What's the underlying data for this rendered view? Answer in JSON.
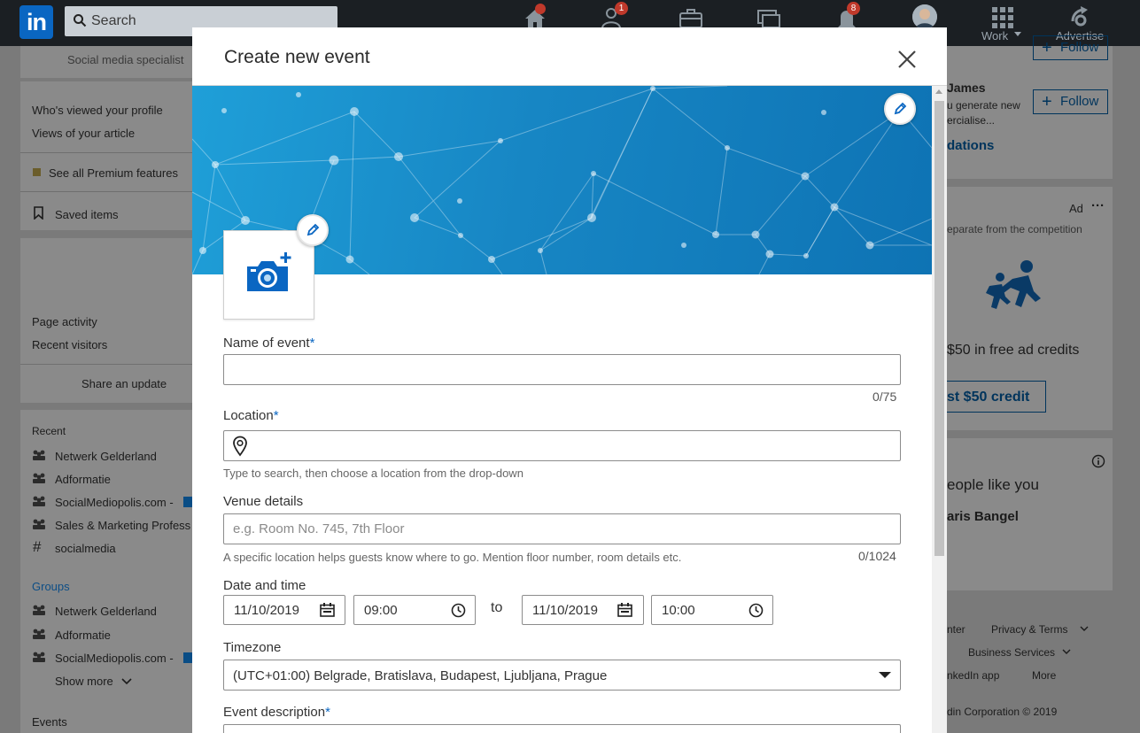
{
  "topnav": {
    "search_placeholder": "Search",
    "badges": {
      "home": "",
      "network": "1",
      "notifications": "8"
    },
    "work_label": "Work",
    "advertise_label": "Advertise"
  },
  "left_sidebar": {
    "profile_headline": "Social media specialist",
    "whos_viewed": "Who's viewed your profile",
    "views_article": "Views of your article",
    "premium": "See all Premium features",
    "saved_items": "Saved items",
    "page_activity": "Page activity",
    "recent_visitors": "Recent visitors",
    "share_update": "Share an update",
    "recent_heading": "Recent",
    "recent_items": [
      "Netwerk Gelderland",
      "Adformatie",
      "SocialMediopolis.com -",
      "Sales & Marketing Profess",
      "socialmedia"
    ],
    "groups_heading": "Groups",
    "group_items": [
      "Netwerk Gelderland",
      "Adformatie",
      "SocialMediopolis.com -"
    ],
    "show_more": "Show more",
    "events_heading": "Events"
  },
  "right_column": {
    "follow_label": "Follow",
    "person_name": "James",
    "person_desc_1": "u generate new",
    "person_desc_2": "ercialise...",
    "recommendations": "dations",
    "ad_label": "Ad",
    "ad_more": "···",
    "ad_tagline": "eparate from the competition",
    "ad_credit": "$50 in free ad credits",
    "ad_button": "st $50 credit",
    "people_heading": "eople like you",
    "people_name": "aris Bangel",
    "footer_links": [
      "nter",
      "Privacy & Terms",
      "Business Services",
      "nkedIn app",
      "More"
    ],
    "copyright": "din Corporation © 2019"
  },
  "modal": {
    "title": "Create new event",
    "name_label": "Name of event",
    "required_mark": "*",
    "name_value": "",
    "name_counter": "0/75",
    "location_label": "Location",
    "location_value": "",
    "location_hint": "Type to search, then choose a location from the drop-down",
    "venue_label": "Venue details",
    "venue_placeholder": "e.g. Room No. 745, 7th Floor",
    "venue_hint": "A specific location helps guests know where to go. Mention floor number, room details etc.",
    "venue_counter": "0/1024",
    "datetime_label": "Date and time",
    "start_date": "11/10/2019",
    "start_time": "09:00",
    "to_label": "to",
    "end_date": "11/10/2019",
    "end_time": "10:00",
    "timezone_label": "Timezone",
    "timezone_value": "(UTC+01:00) Belgrade, Bratislava, Budapest, Ljubljana, Prague",
    "description_label": "Event description"
  },
  "colors": {
    "brand": "#0a66c2",
    "nav_bg": "#1b1f23",
    "banner": "#1786c4"
  }
}
